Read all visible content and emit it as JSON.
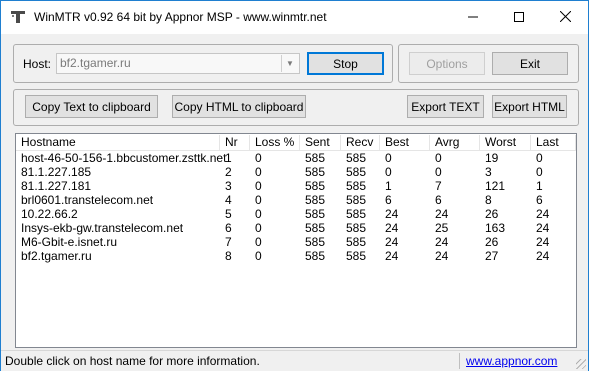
{
  "window": {
    "title": "WinMTR v0.92 64 bit by Appnor MSP - www.winmtr.net"
  },
  "host": {
    "label": "Host:",
    "value": "bf2.tgamer.ru"
  },
  "buttons": {
    "stop": "Stop",
    "options": "Options",
    "exit": "Exit",
    "copy_text": "Copy Text to clipboard",
    "copy_html": "Copy HTML to clipboard",
    "export_text": "Export TEXT",
    "export_html": "Export HTML"
  },
  "table": {
    "columns": [
      "Hostname",
      "Nr",
      "Loss %",
      "Sent",
      "Recv",
      "Best",
      "Avrg",
      "Worst",
      "Last"
    ],
    "rows": [
      [
        "host-46-50-156-1.bbcustomer.zsttk.net",
        "1",
        "0",
        "585",
        "585",
        "0",
        "0",
        "19",
        "0"
      ],
      [
        "81.1.227.185",
        "2",
        "0",
        "585",
        "585",
        "0",
        "0",
        "3",
        "0"
      ],
      [
        "81.1.227.181",
        "3",
        "0",
        "585",
        "585",
        "1",
        "7",
        "121",
        "1"
      ],
      [
        "brl0601.transtelecom.net",
        "4",
        "0",
        "585",
        "585",
        "6",
        "6",
        "8",
        "6"
      ],
      [
        "10.22.66.2",
        "5",
        "0",
        "585",
        "585",
        "24",
        "24",
        "26",
        "24"
      ],
      [
        "Insys-ekb-gw.transtelecom.net",
        "6",
        "0",
        "585",
        "585",
        "24",
        "25",
        "163",
        "24"
      ],
      [
        "M6-Gbit-e.isnet.ru",
        "7",
        "0",
        "585",
        "585",
        "24",
        "24",
        "26",
        "24"
      ],
      [
        "bf2.tgamer.ru",
        "8",
        "0",
        "585",
        "585",
        "24",
        "24",
        "27",
        "24"
      ]
    ]
  },
  "status": {
    "text": "Double click on host name for more information.",
    "link": "www.appnor.com"
  }
}
